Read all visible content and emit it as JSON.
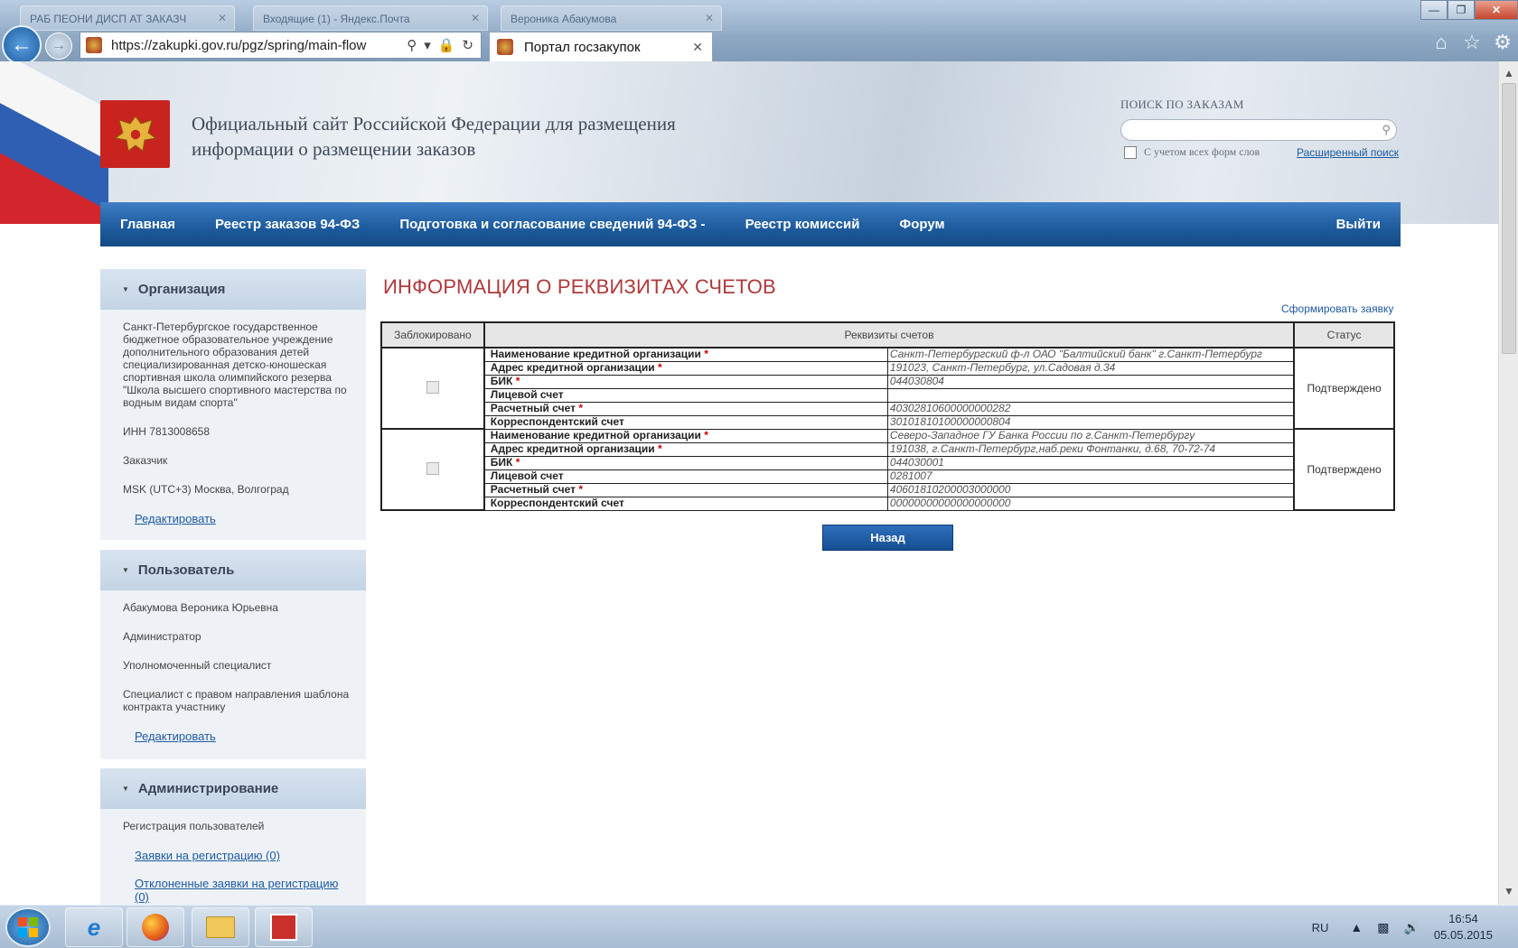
{
  "browser": {
    "bg_tabs": [
      "РАБ ПЕОНИ ДИСП АТ ЗАКАЗЧ",
      "Входящие (1) - Яндекс.Почта",
      "Вероника Абакумова"
    ],
    "url": "https://zakupki.gov.ru/pgz/spring/main-flow",
    "tab_title": "Портал госзакупок",
    "close_glyph": "✕",
    "win_minimize": "—",
    "win_maximize": "❐",
    "win_close": "✕"
  },
  "header": {
    "site_title": "Официальный сайт Российской Федерации для размещения информации о размещении заказов",
    "search_label": "ПОИСК ПО ЗАКАЗАМ",
    "word_forms_label": "С учетом всех форм слов",
    "advanced_search": "Расширенный поиск"
  },
  "nav": {
    "items": [
      "Главная",
      "Реестр заказов 94-ФЗ",
      "Подготовка и согласование сведений 94-ФЗ  -",
      "Реестр комиссий",
      "Форум"
    ],
    "logout": "Выйти"
  },
  "sidebar": {
    "org": {
      "title": "Организация",
      "name": "Санкт-Петербургское государственное бюджетное образовательное учреждение дополнительного образования детей специализированная детско-юношеская спортивная школа олимпийского резерва \"Школа высшего спортивного мастерства по водным видам спорта\"",
      "inn": "ИНН 7813008658",
      "role": "Заказчик",
      "timezone": "MSK (UTC+3) Москва, Волгоград",
      "edit": "Редактировать"
    },
    "user": {
      "title": "Пользователь",
      "name": "Абакумова Вероника Юрьевна",
      "role1": "Администратор",
      "role2": "Уполномоченный специалист",
      "role3": "Специалист с правом направления шаблона контракта участнику",
      "edit": "Редактировать"
    },
    "admin": {
      "title": "Администрирование",
      "section": "Регистрация пользователей",
      "link1": "Заявки на регистрацию (0)",
      "link2": "Отклоненные заявки на регистрацию (0)"
    }
  },
  "main": {
    "title": "ИНФОРМАЦИЯ О РЕКВИЗИТАХ СЧЕТОВ",
    "form_link": "Сформировать заявку",
    "col_blocked": "Заблокировано",
    "col_details": "Реквизиты счетов",
    "col_status": "Статус",
    "required_mark": "*",
    "accounts": [
      {
        "status": "Подтверждено",
        "rows": [
          {
            "label": "Наименование кредитной организации",
            "required": true,
            "value": "Санкт-Петербургский ф-л ОАО \"Балтийский банк\" г.Санкт-Петербург"
          },
          {
            "label": "Адрес кредитной организации",
            "required": true,
            "value": "191023, Санкт-Петербург, ул.Садовая д.34"
          },
          {
            "label": "БИК",
            "required": true,
            "value": "044030804"
          },
          {
            "label": "Лицевой счет",
            "required": false,
            "value": ""
          },
          {
            "label": "Расчетный счет",
            "required": true,
            "value": "40302810600000000282"
          },
          {
            "label": "Корреспондентский счет",
            "required": false,
            "value": "30101810100000000804"
          }
        ]
      },
      {
        "status": "Подтверждено",
        "rows": [
          {
            "label": "Наименование кредитной организации",
            "required": true,
            "value": "Северо-Западное ГУ Банка России по г.Санкт-Петербургу"
          },
          {
            "label": "Адрес кредитной организации",
            "required": true,
            "value": "191038, г.Санкт-Петербург,наб.реки Фонтанки, д.68, 70-72-74"
          },
          {
            "label": "БИК",
            "required": true,
            "value": "044030001"
          },
          {
            "label": "Лицевой счет",
            "required": false,
            "value": "0281007"
          },
          {
            "label": "Расчетный счет",
            "required": true,
            "value": "40601810200003000000"
          },
          {
            "label": "Корреспондентский счет",
            "required": false,
            "value": "00000000000000000000"
          }
        ]
      }
    ],
    "back_button": "Назад"
  },
  "taskbar": {
    "lang": "RU",
    "time": "16:54",
    "date": "05.05.2015"
  }
}
